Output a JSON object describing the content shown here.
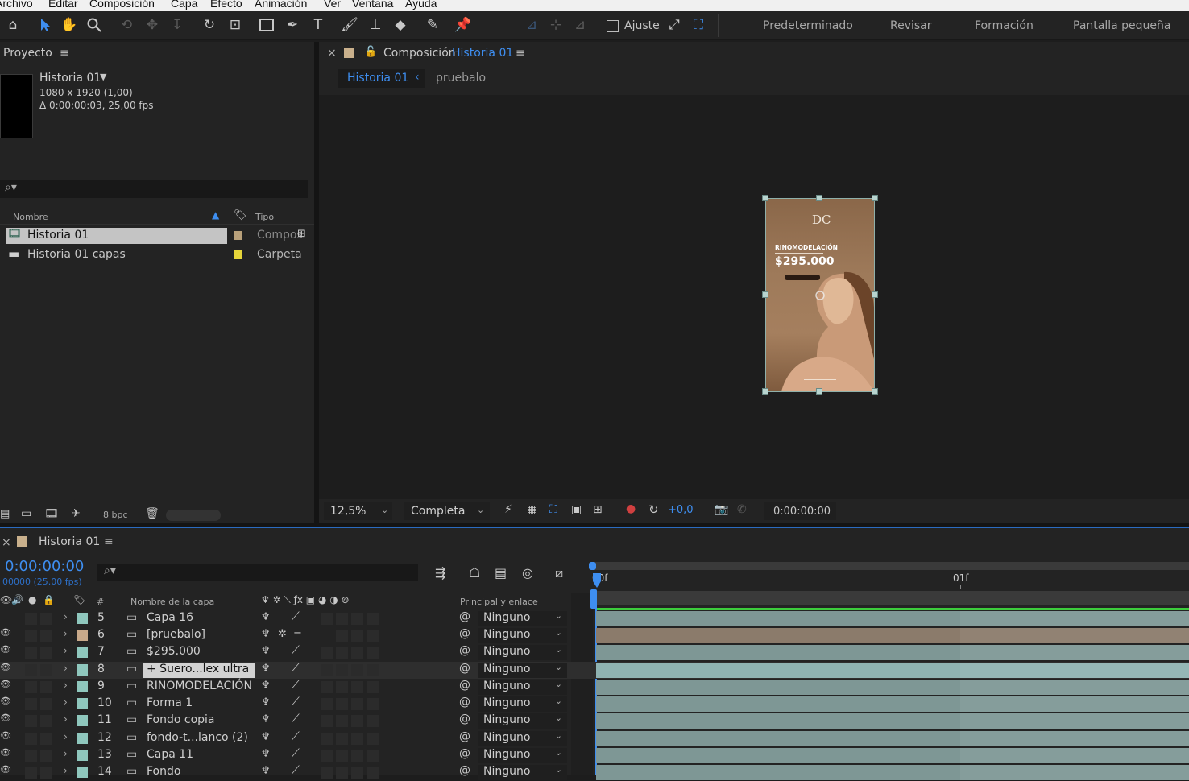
{
  "menu": [
    "Archivo",
    "Editar",
    "Composición",
    "Capa",
    "Efecto",
    "Animación",
    "Ver",
    "Ventana",
    "Ayuda"
  ],
  "toolbar": {
    "icons": [
      "home-icon",
      "selection-arrow-icon",
      "hand-icon",
      "zoom-icon",
      "orbit-icon",
      "pan-icon",
      "dolly-icon",
      "rotate-icon",
      "pan-behind-icon",
      "rectangle-icon",
      "pen-icon",
      "text-icon",
      "brush-icon",
      "stamp-icon",
      "eraser-icon",
      "roto-brush-icon",
      "puppet-pin-icon"
    ],
    "snap_label": "Ajuste",
    "workspaces": [
      "Predeterminado",
      "Revisar",
      "Formación",
      "Pantalla pequeña"
    ]
  },
  "project": {
    "title": "Proyecto",
    "selected_name": "Historia 01",
    "selected_info1": "1080 x 1920 (1,00)",
    "selected_info2": "Δ 0:00:00:03, 25,00 fps",
    "search_placeholder": "",
    "col_name": "Nombre",
    "col_type": "Tipo",
    "items": [
      {
        "name": "Historia 01",
        "type": "Compos",
        "color": "#b8a07a",
        "selected": true
      },
      {
        "name": "Historia 01 capas",
        "type": "Carpeta",
        "color": "#e6d53a",
        "selected": false
      }
    ],
    "bpc": "8 bpc"
  },
  "composition": {
    "tab_prefix": "Composición",
    "tab_name": "Historia 01",
    "breadcrumb": [
      "Historia 01",
      "pruebalo"
    ],
    "preview": {
      "headline": "RINOMODELACIÓN",
      "price": "$295.000",
      "logo": "DC"
    },
    "zoom": "12,5%",
    "resolution": "Completa",
    "exposure": "+0,0",
    "timecode": "0:00:00:00"
  },
  "timeline": {
    "tab": "Historia 01",
    "timecode": "0:00:00:00",
    "fps_sub": "00000 (25.00 fps)",
    "ruler": [
      "00f",
      "01f"
    ],
    "col_layer": "Nombre de la capa",
    "col_num": "#",
    "col_parent": "Principal y enlace",
    "layers": [
      {
        "num": "5",
        "name": "Capa 16",
        "color": "#8fc7bd",
        "parent": "Ninguno",
        "bar": "#7e9795"
      },
      {
        "num": "6",
        "name": "[pruebalo]",
        "color": "#c8a98a",
        "parent": "Ninguno",
        "bar": "#8b7b6b"
      },
      {
        "num": "7",
        "name": "$295.000",
        "color": "#8fc7bd",
        "parent": "Ninguno",
        "bar": "#7e9795"
      },
      {
        "num": "8",
        "name": "+ Suero...lex ultra",
        "color": "#8fc7bd",
        "parent": "Ninguno",
        "bar": "#8fb3b2"
      },
      {
        "num": "9",
        "name": "RINOMODELACIÓN",
        "color": "#8fc7bd",
        "parent": "Ninguno",
        "bar": "#7e9795"
      },
      {
        "num": "10",
        "name": "Forma 1",
        "color": "#8fc7bd",
        "parent": "Ninguno",
        "bar": "#7e9795"
      },
      {
        "num": "11",
        "name": "Fondo copia",
        "color": "#8fc7bd",
        "parent": "Ninguno",
        "bar": "#7e9795"
      },
      {
        "num": "12",
        "name": "fondo-t...lanco (2)",
        "color": "#8fc7bd",
        "parent": "Ninguno",
        "bar": "#7e9795"
      },
      {
        "num": "13",
        "name": "Capa 11",
        "color": "#8fc7bd",
        "parent": "Ninguno",
        "bar": "#7e9795"
      },
      {
        "num": "14",
        "name": "Fondo",
        "color": "#8fc7bd",
        "parent": "Ninguno",
        "bar": "#7e9795"
      }
    ]
  }
}
